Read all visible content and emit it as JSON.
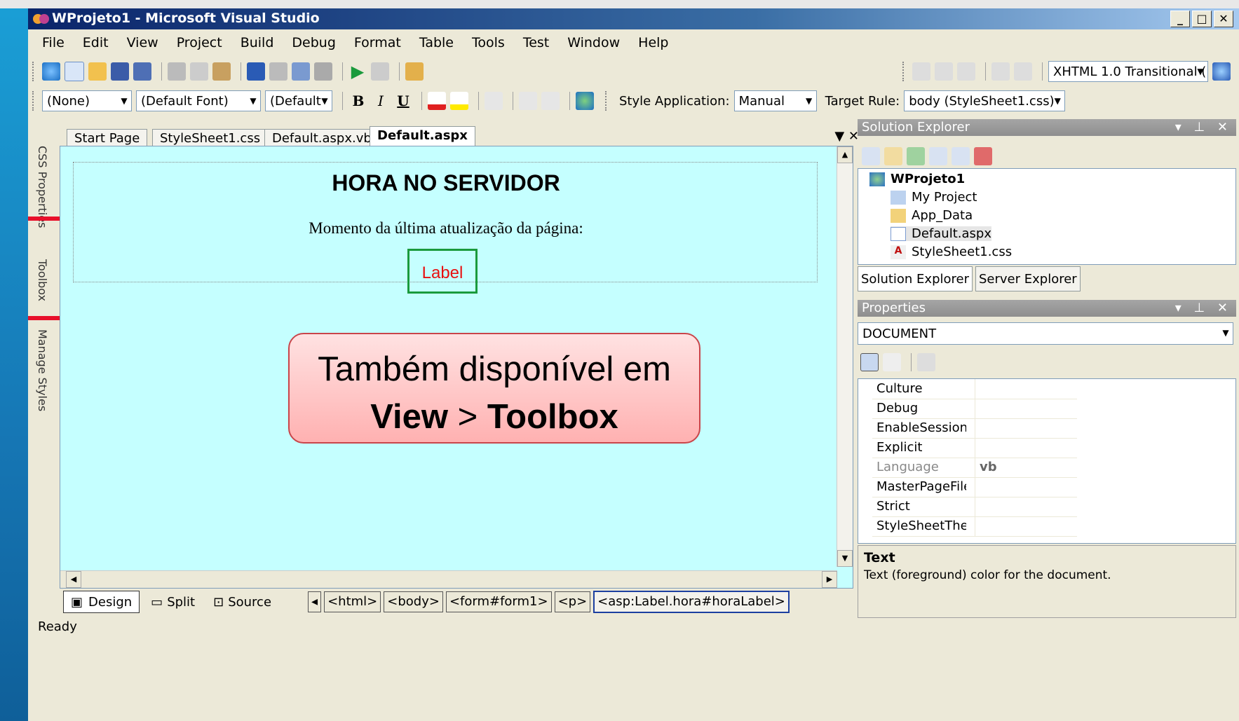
{
  "window": {
    "title": "WProjeto1 - Microsoft Visual Studio",
    "min": "_",
    "max": "□",
    "close": "✕"
  },
  "menu": [
    "File",
    "Edit",
    "View",
    "Project",
    "Build",
    "Debug",
    "Format",
    "Table",
    "Tools",
    "Test",
    "Window",
    "Help"
  ],
  "toolbar1": {
    "doctype": "XHTML 1.0 Transitional ("
  },
  "toolbar2": {
    "style": "(None)",
    "font": "(Default Font)",
    "size": "(Default",
    "bold": "B",
    "italic": "I",
    "underline": "U",
    "style_app_label": "Style Application:",
    "style_app_value": "Manual",
    "target_label": "Target Rule:",
    "target_value": "body (StyleSheet1.css)"
  },
  "sidebar": [
    "CSS Properties",
    "Toolbox",
    "Manage Styles"
  ],
  "tabs": [
    "Start Page",
    "StyleSheet1.css",
    "Default.aspx.vb",
    "Default.aspx"
  ],
  "design": {
    "heading": "HORA NO SERVIDOR",
    "subtitle": "Momento da última atualização da página:",
    "label": "Label"
  },
  "callout": {
    "line1": "Também disponível em",
    "view": "View",
    "sep": " > ",
    "toolbox": "Toolbox"
  },
  "viewbuttons": [
    "Design",
    "Split",
    "Source"
  ],
  "breadcrumbs": [
    "<html>",
    "<body>",
    "<form#form1>",
    "<p>",
    "<asp:Label.hora#horaLabel>"
  ],
  "status": "Ready",
  "solution_explorer": {
    "title": "Solution Explorer",
    "items": [
      "WProjeto1",
      "My Project",
      "App_Data",
      "Default.aspx",
      "StyleSheet1.css"
    ],
    "tabs": [
      "Solution Explorer",
      "Server Explorer"
    ]
  },
  "properties": {
    "title": "Properties",
    "object": "DOCUMENT",
    "rows": [
      {
        "name": "Culture",
        "value": ""
      },
      {
        "name": "Debug",
        "value": ""
      },
      {
        "name": "EnableSessionSt",
        "value": ""
      },
      {
        "name": "Explicit",
        "value": ""
      },
      {
        "name": "Language",
        "value": "vb"
      },
      {
        "name": "MasterPageFile",
        "value": ""
      },
      {
        "name": "Strict",
        "value": ""
      },
      {
        "name": "StyleSheetThem",
        "value": ""
      }
    ],
    "desc_title": "Text",
    "desc_text": "Text (foreground) color for the document."
  }
}
